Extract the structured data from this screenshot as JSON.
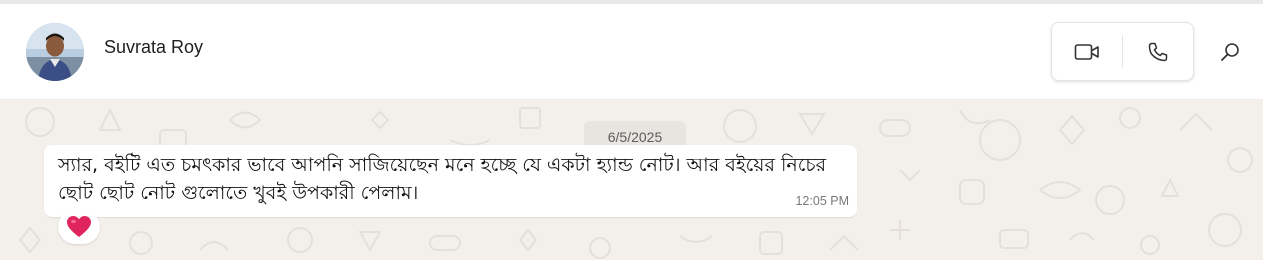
{
  "contact": {
    "name": "Suvrata Roy"
  },
  "header": {
    "video_call_icon": "video-camera-icon",
    "voice_call_icon": "phone-icon",
    "search_icon": "search-icon"
  },
  "chat": {
    "date_label": "6/5/2025",
    "messages": [
      {
        "text": "স্যার, বইটি এত চমৎকার ভাবে আপনি সাজিয়েছেন মনে হচ্ছে যে একটা হ্যান্ড নোট। আর বইয়ের নিচের ছোট ছোট নোট গুলোতে খুবই উপকারী পেলাম।",
        "time": "12:05 PM",
        "reaction": "❤️"
      }
    ]
  },
  "colors": {
    "chat_background": "#f3f0eb",
    "bubble": "#ffffff",
    "reaction_heart": "#e0245e"
  }
}
